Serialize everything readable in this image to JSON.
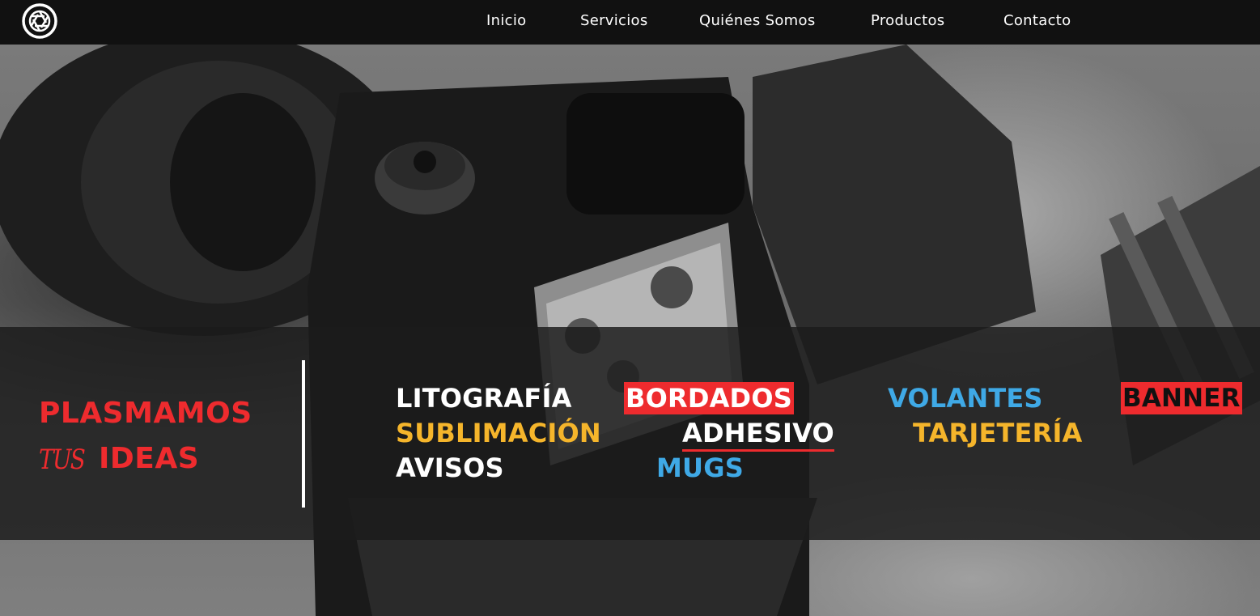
{
  "header": {
    "logo_icon": "camera-aperture-icon",
    "nav": [
      {
        "label": "Inicio"
      },
      {
        "label": "Servicios"
      },
      {
        "label": "Quiénes Somos"
      },
      {
        "label": "Productos"
      },
      {
        "label": "Contacto"
      }
    ]
  },
  "hero": {
    "background": "camera-photo-grayscale",
    "tagline": {
      "line1": "PLASMAMOS",
      "line2_script": "TUS",
      "line2_bold": "IDEAS",
      "color": "#ee2b2e"
    },
    "services": [
      {
        "label": "LITOGRAFÍA",
        "color": "#ffffff",
        "style": "plain"
      },
      {
        "label": "BORDADOS",
        "color": "#ffffff",
        "style": "red-box"
      },
      {
        "label": "VOLANTES",
        "color": "#3fa9e6",
        "style": "plain"
      },
      {
        "label": "BANNER",
        "color": "#111111",
        "style": "red-box"
      },
      {
        "label": "SUBLIMACIÓN",
        "color": "#f5b52b",
        "style": "plain"
      },
      {
        "label": "ADHESIVO",
        "color": "#ffffff",
        "style": "red-underline"
      },
      {
        "label": "TARJETERÍA",
        "color": "#f5b52b",
        "style": "plain"
      },
      {
        "label": "AVISOS",
        "color": "#ffffff",
        "style": "plain"
      },
      {
        "label": "MUGS",
        "color": "#3fa9e6",
        "style": "plain"
      }
    ]
  }
}
